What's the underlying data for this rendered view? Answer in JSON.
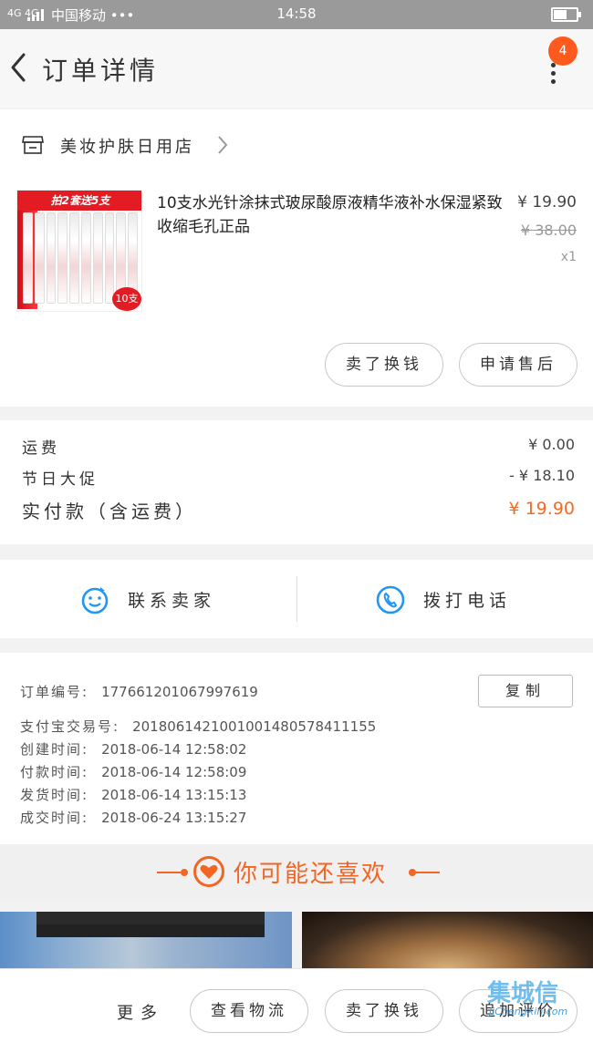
{
  "status_bar": {
    "network": "4G 4G",
    "carrier": "中国移动 •••",
    "time": "14:58"
  },
  "nav": {
    "title": "订单详情",
    "badge_count": "4"
  },
  "shop": {
    "name": "美妆护肤日用店"
  },
  "product": {
    "image_banner": "拍2套送5支",
    "image_tag": "10支",
    "title": "10支水光针涂抹式玻尿酸原液精华液补水保湿紧致收缩毛孔正品",
    "price": "¥ 19.90",
    "original_price": "¥ 38.00",
    "quantity": "x1",
    "actions": {
      "resell": "卖了换钱",
      "after_sale": "申请售后"
    }
  },
  "fees": {
    "shipping_label": "运费",
    "shipping_value": "¥ 0.00",
    "promo_label": "节日大促",
    "promo_value": "- ¥ 18.10",
    "total_label": "实付款（含运费）",
    "total_value": "¥ 19.90"
  },
  "contact": {
    "seller": "联系卖家",
    "call": "拨打电话"
  },
  "order_info": {
    "copy_label": "复制",
    "rows": [
      {
        "key": "订单编号:",
        "value": "177661201067997619"
      },
      {
        "key": "支付宝交易号:",
        "value": "2018061421001001480578411155"
      },
      {
        "key": "创建时间:",
        "value": "2018-06-14 12:58:02"
      },
      {
        "key": "付款时间:",
        "value": "2018-06-14 12:58:09"
      },
      {
        "key": "发货时间:",
        "value": "2018-06-14 13:15:13"
      },
      {
        "key": "成交时间:",
        "value": "2018-06-24 13:15:27"
      }
    ]
  },
  "recommend": {
    "title": "你可能还喜欢"
  },
  "bottom_bar": {
    "more": "更多",
    "logistics": "查看物流",
    "resell": "卖了换钱",
    "review": "追加评价"
  },
  "watermark": {
    "logo": "集城信",
    "site": "JiChengXin.com"
  },
  "colors": {
    "accent": "#f26522",
    "badge": "#ff5a1e",
    "icon_blue": "#2196f3"
  }
}
